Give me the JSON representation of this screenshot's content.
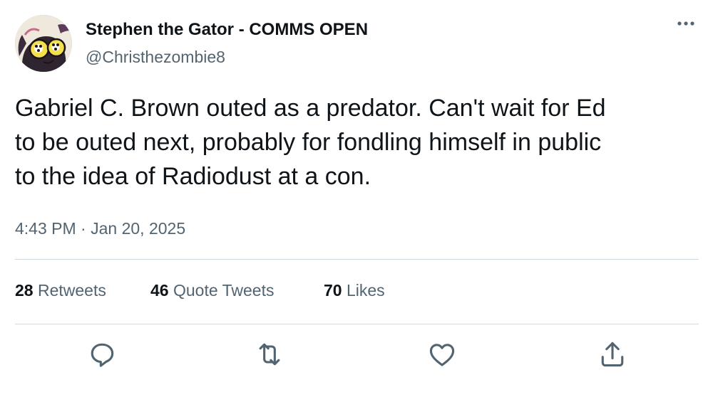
{
  "author": {
    "display_name": "Stephen the Gator - COMMS OPEN",
    "handle": "@Christhezombie8"
  },
  "tweet": {
    "text": "Gabriel C. Brown outed as a predator. Can't wait for Ed\nto be outed next, probably for fondling himself in public\nto the idea of Radiodust at a con.",
    "time": "4:43 PM",
    "separator": "·",
    "date": "Jan 20, 2025"
  },
  "stats": {
    "retweets": {
      "count": "28",
      "label": "Retweets"
    },
    "quote_tweets": {
      "count": "46",
      "label": "Quote Tweets"
    },
    "likes": {
      "count": "70",
      "label": "Likes"
    }
  },
  "icons": {
    "more": "more-horizontal-icon",
    "reply": "reply-icon",
    "retweet": "retweet-icon",
    "like": "heart-icon",
    "share": "share-icon"
  },
  "colors": {
    "text_primary": "#0f1419",
    "text_secondary": "#536471",
    "divider": "#cfd9de"
  }
}
